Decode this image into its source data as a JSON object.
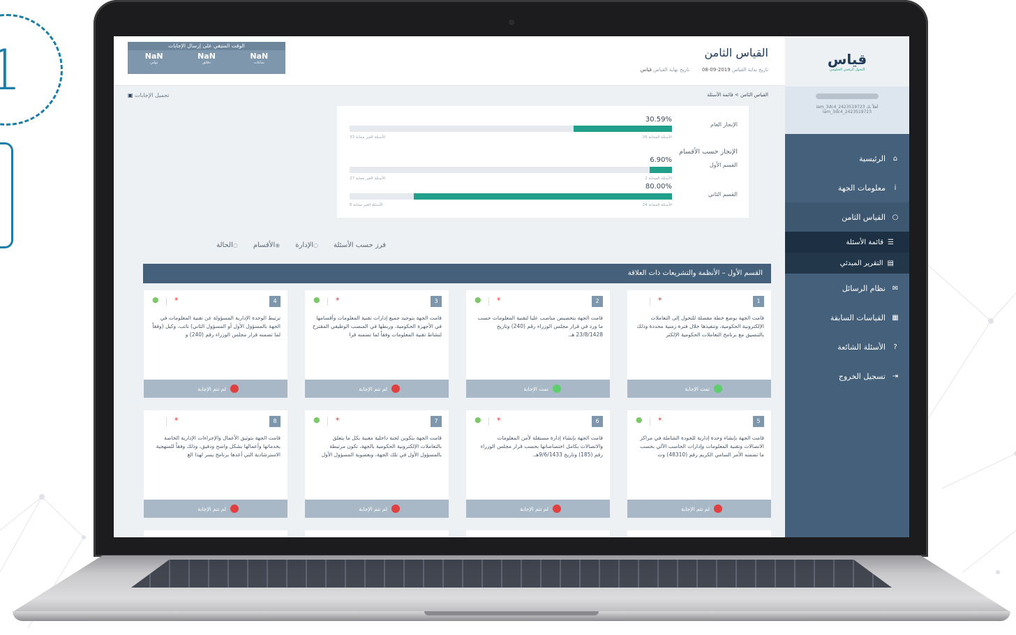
{
  "badge": {
    "number": "1"
  },
  "app": {
    "logo": "قياس",
    "logo_sub": "التحول الرقمي الحكومي",
    "page_title": "القياس الثامن",
    "meta_start_label": "تاريخ بداية القياس",
    "meta_start_value": "2019-09-08",
    "meta_end_label": "تاريخ نهاية القياس",
    "meta_end_value": "قياس",
    "breadcrumb": "القياس الثامن > قائمة الأسئلة",
    "download": "تحميل الإجابات"
  },
  "timer": {
    "title": "الوقت المتبقي على إرسال الإجابات",
    "cols": [
      {
        "value": "NaN",
        "unit": "ثواني"
      },
      {
        "value": "NaN",
        "unit": "دقائق"
      },
      {
        "value": "NaN",
        "unit": "ساعات"
      }
    ]
  },
  "user": {
    "line1": "أهلاً بك iam_3dc4_2423519723",
    "line2": "iam_3dc4_2423519723"
  },
  "sidebar": {
    "items": [
      {
        "label": "الرئيسية",
        "icon": "home-icon",
        "glyph": "⌂"
      },
      {
        "label": "معلومات الجهة",
        "icon": "info-icon",
        "glyph": "i"
      },
      {
        "label": "القياس الثامن",
        "icon": "circle-icon",
        "glyph": "○"
      },
      {
        "label": "قائمة الأسئلة",
        "icon": "list-icon",
        "glyph": "☰"
      },
      {
        "label": "التقرير المبدئي",
        "icon": "chart-icon",
        "glyph": "▤"
      },
      {
        "label": "نظام الرسائل",
        "icon": "envelope-icon",
        "glyph": "✉"
      },
      {
        "label": "القياسات السابقة",
        "icon": "area-chart-icon",
        "glyph": "▦"
      },
      {
        "label": "الأسئلة الشائعة",
        "icon": "question-icon",
        "glyph": "?"
      },
      {
        "label": "تسجيل الخروج",
        "icon": "logout-icon",
        "glyph": "⇥"
      }
    ]
  },
  "progress": {
    "overall_label": "الإنجاز العام",
    "overall_pct": "30.59%",
    "overall_value": 0.3059,
    "overall_answered": "الأسئلة المجابة 26",
    "overall_unanswered": "الأسئلة الغير مجابة 33",
    "sections_label": "الإنجاز حسب الأقسام",
    "sections": [
      {
        "label": "القسم الأول",
        "pct": "6.90%",
        "value": 0.069,
        "answered": "الأسئلة المجابة 2",
        "unanswered": "الأسئلة الغير مجابة 27"
      },
      {
        "label": "القسم الثاني",
        "pct": "80.00%",
        "value": 0.8,
        "answered": "الأسئلة المجابة 24",
        "unanswered": "الأسئلة الغير مجابة 6"
      }
    ]
  },
  "sort": {
    "label": "فرز حسب الأسئلة",
    "options": [
      {
        "label": "الإدارة",
        "selected": false
      },
      {
        "label": "الأقسام",
        "selected": true
      },
      {
        "label": "الحالة",
        "selected": false
      }
    ]
  },
  "section_title": "القسم الأول – الأنظمة والتشريعات ذات العلاقة",
  "cards": [
    {
      "num": "1",
      "text": "قامت الجهة بوضع خطة مفصلة للتحول إلى التعاملات الإلكترونية الحكومية، وتنفيذها خلال فترة زمنية محددة وذلك بالتنسيق مع برنامج التعاملات الحكومية الإلكتر",
      "status": "تمت الإجابة",
      "answered": true,
      "attachment": false
    },
    {
      "num": "2",
      "text": "قامت الجهة بتخصيص مناصب عليا لتقنية المعلومات حسب ما ورد في قرار مجلس الوزراء رقم (240) وتاريخ 23/8/1428 هـ.",
      "status": "تمت الإجابة",
      "answered": true,
      "attachment": true
    },
    {
      "num": "3",
      "text": "قامت الجهة بتوحيد جميع إدارات تقنية المعلومات وأقسامها في الأجهزة الحكومية، وربطها في المنصب الوظيفي المقترح لنشاط تقنية المعلومات وفقاً لما تضمنه قرا",
      "status": "لم تتم الإجابة",
      "answered": false,
      "attachment": true
    },
    {
      "num": "4",
      "text": "ترتبط الوحدة الإدارية المسؤولة عن تقنية المعلومات في الجهة بالمسؤول الأول أو المسؤول الثاني) نائب، وكيل (وفقاً لما تضمنه قرار مجلس الوزراء رقم (240) و",
      "status": "لم تتم الإجابة",
      "answered": false,
      "attachment": true
    },
    {
      "num": "5",
      "text": "قامت الجهة بإنشاء وحدة إدارية للجودة الشاملة في مراكز الاتصالات وتقنية المعلومات وإدارات الحاسب الآلي بحسب ما تضمنه الأمر السامي الكريم رقم (48310) وت",
      "status": "لم تتم الإجابة",
      "answered": false,
      "attachment": true
    },
    {
      "num": "6",
      "text": "قامت الجهة بإنشاء إدارة مستقلة لأمن المعلومات والاتصالات بكامل اختصاصاتها بحسب قرار مجلس الوزراء رقم (185) وتاريخ 9/6/1433هـ.",
      "status": "لم تتم الإجابة",
      "answered": false,
      "attachment": true
    },
    {
      "num": "7",
      "text": "قامت الجهة بتكوين لجنة داخلية معنية بكل ما يتعلق بالتعاملات الإلكترونية الحكومية بالجهة، تكون مرتبطة بالمسؤول الأول في تلك الجهة، وبعضوية المسؤول الأول",
      "status": "لم تتم الإجابة",
      "answered": false,
      "attachment": true
    },
    {
      "num": "8",
      "text": "قامت الجهة بتوثيق الأعمال والإجراءات الإدارية الخاصة بخدماتها وأعمالها بشكل واضح ودقيق، وذلك وفقاً للمنهجية الاسترشادية التي أعدها برنامج يسر لهذا الغ",
      "status": "لم تتم الإجابة",
      "answered": false,
      "attachment": false
    }
  ],
  "colors": {
    "accent": "#20a08b",
    "sidebar": "#44607a",
    "badge": "#1a7ea8"
  }
}
